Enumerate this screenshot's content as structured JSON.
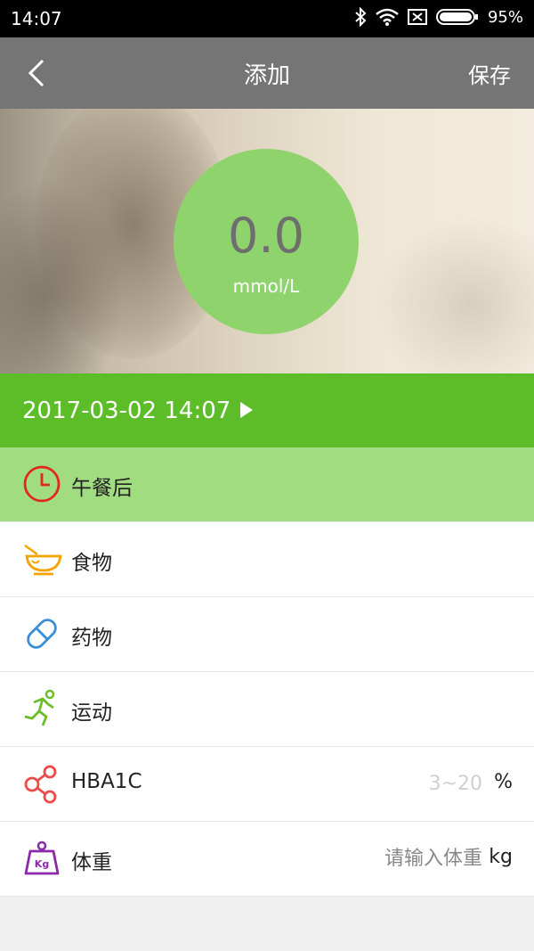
{
  "status": {
    "time": "14:07",
    "battery": "95%"
  },
  "appbar": {
    "title": "添加",
    "save_label": "保存"
  },
  "gauge": {
    "value": "0.0",
    "unit": "mmol/L"
  },
  "datetime": {
    "text": "2017-03-02 14:07"
  },
  "meal": {
    "label": "午餐后"
  },
  "rows": {
    "food": "食物",
    "medicine": "药物",
    "exercise": "运动",
    "hba1c": {
      "label": "HBA1C",
      "placeholder": "3~20",
      "unit": "%"
    },
    "weight": {
      "label": "体重",
      "placeholder": "请输入体重",
      "unit": "kg"
    }
  },
  "colors": {
    "green": "#5dbd29",
    "light_green": "#a2dc81",
    "gauge": "#8fd36c",
    "appbar": "#757575"
  }
}
